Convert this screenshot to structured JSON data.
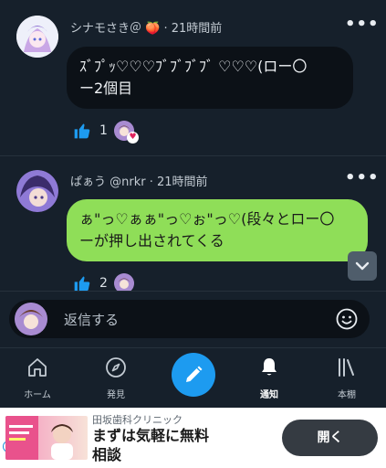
{
  "comments": [
    {
      "author": "シナモさき＠ 🍑",
      "time": "21時間前",
      "text_line1": "ｽﾞﾌﾟｯ♡♡♡ﾌﾞﾌﾞﾌﾞﾌﾞ ♡♡♡(ロー〇",
      "text_line2": "ー2個目",
      "likes": "1",
      "menu": "•••",
      "bubble_color": "#0c1117"
    },
    {
      "author": "ぱぁう @nrkr",
      "time": "21時間前",
      "text_line1": "ぁ\"っ♡ぁぁ\"っ♡ぉ\"っ♡(段々とロー〇",
      "text_line2": "ーが押し出されてくる",
      "likes": "2",
      "menu": "•••",
      "bubble_color": "#8fde58"
    }
  ],
  "reply": {
    "placeholder": "返信する"
  },
  "nav": {
    "home": "ホーム",
    "discover": "発見",
    "notifications": "通知",
    "bookshelf": "本棚"
  },
  "ad": {
    "advertiser": "田坂歯科クリニック",
    "headline_line1": "まずは気軽に無料",
    "headline_line2": "相談",
    "cta": "開く"
  },
  "colors": {
    "accent": "#1d9bf0",
    "background": "#16202b",
    "like": "#1d9bf0"
  }
}
